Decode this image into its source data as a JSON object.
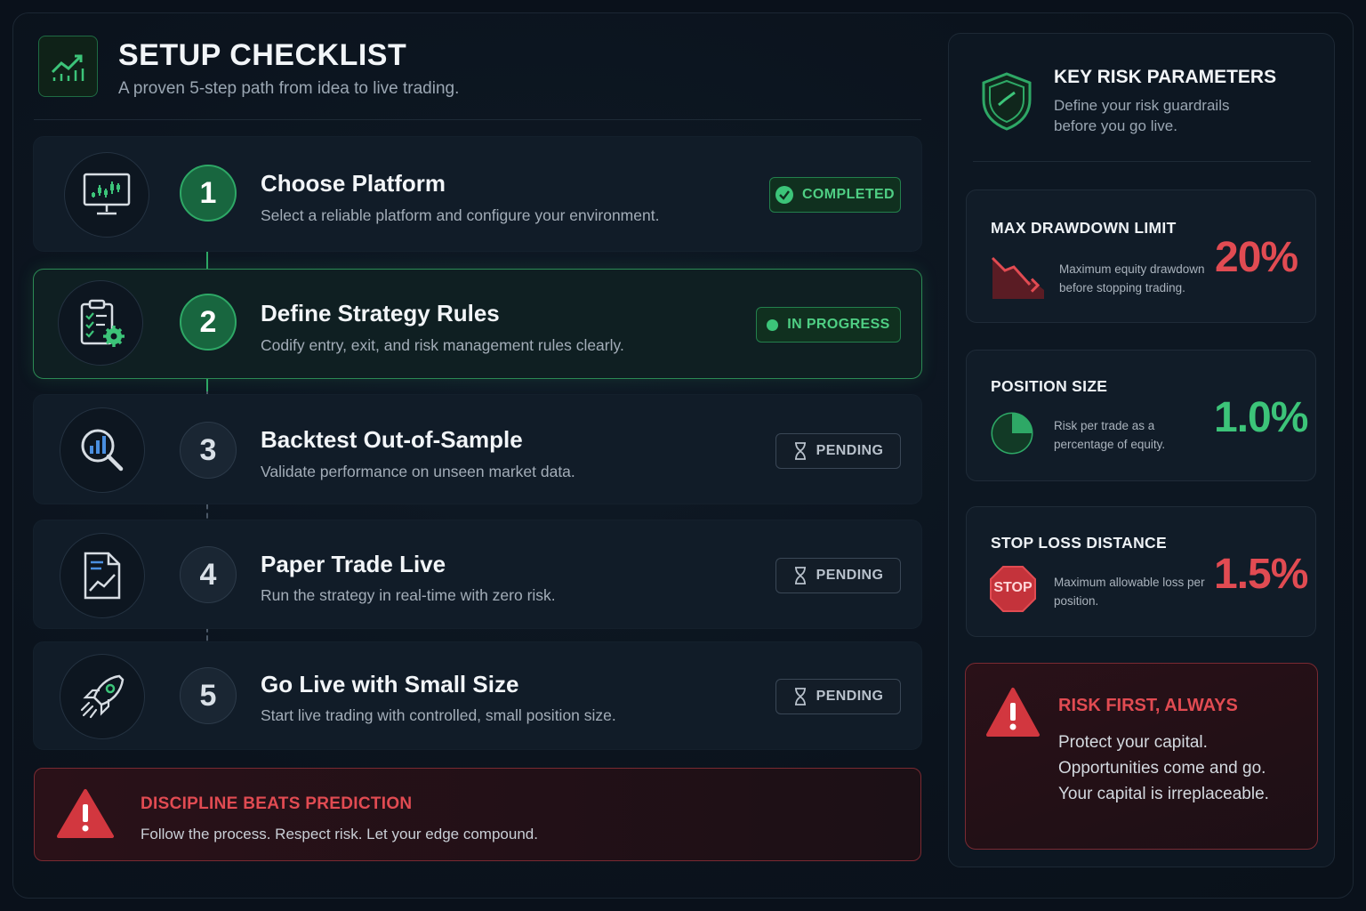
{
  "colors": {
    "accent_green": "#2ea866",
    "danger_red": "#e14b52",
    "background": "#0a111b"
  },
  "header": {
    "icon": "chart-trend-up-icon",
    "title": "SETUP CHECKLIST",
    "subtitle": "A proven 5-step path from idea to live trading."
  },
  "steps": [
    {
      "number": "1",
      "icon": "monitor-chart-icon",
      "title": "Choose Platform",
      "description": "Select a reliable platform and configure your environment.",
      "status": "COMPLETED"
    },
    {
      "number": "2",
      "icon": "clipboard-gear-icon",
      "title": "Define Strategy Rules",
      "description": "Codify entry, exit, and risk management rules clearly.",
      "status": "IN PROGRESS"
    },
    {
      "number": "3",
      "icon": "magnifier-chart-icon",
      "title": "Backtest Out-of-Sample",
      "description": "Validate performance on unseen market data.",
      "status": "PENDING"
    },
    {
      "number": "4",
      "icon": "document-chart-icon",
      "title": "Paper Trade Live",
      "description": "Run the strategy in real-time with zero risk.",
      "status": "PENDING"
    },
    {
      "number": "5",
      "icon": "rocket-icon",
      "title": "Go Live with Small Size",
      "description": "Start live trading with controlled, small position size.",
      "status": "PENDING"
    }
  ],
  "discipline_alert": {
    "icon": "warning-triangle-icon",
    "title": "DISCIPLINE BEATS PREDICTION",
    "text": "Follow the process. Respect risk. Let your edge compound."
  },
  "risk_panel": {
    "icon": "shield-check-icon",
    "title": "KEY RISK PARAMETERS",
    "subtitle": "Define your risk guardrails before you go live.",
    "cards": [
      {
        "title": "MAX DRAWDOWN LIMIT",
        "icon": "trend-down-icon",
        "description": "Maximum equity drawdown before stopping trading.",
        "value": "20%",
        "color": "#e14b52"
      },
      {
        "title": "POSITION SIZE",
        "icon": "pie-chart-icon",
        "description": "Risk per trade as a percentage of equity.",
        "value": "1.0%",
        "color": "#2ea866"
      },
      {
        "title": "STOP LOSS DISTANCE",
        "icon": "stop-sign-icon",
        "stop_text": "STOP",
        "description": "Maximum allowable loss per position.",
        "value": "1.5%",
        "color": "#e14b52"
      }
    ]
  },
  "risk_first": {
    "icon": "warning-triangle-icon",
    "title": "RISK FIRST, ALWAYS",
    "lines": [
      "Protect your capital.",
      "Opportunities come and go.",
      "Your capital is irreplaceable."
    ]
  }
}
